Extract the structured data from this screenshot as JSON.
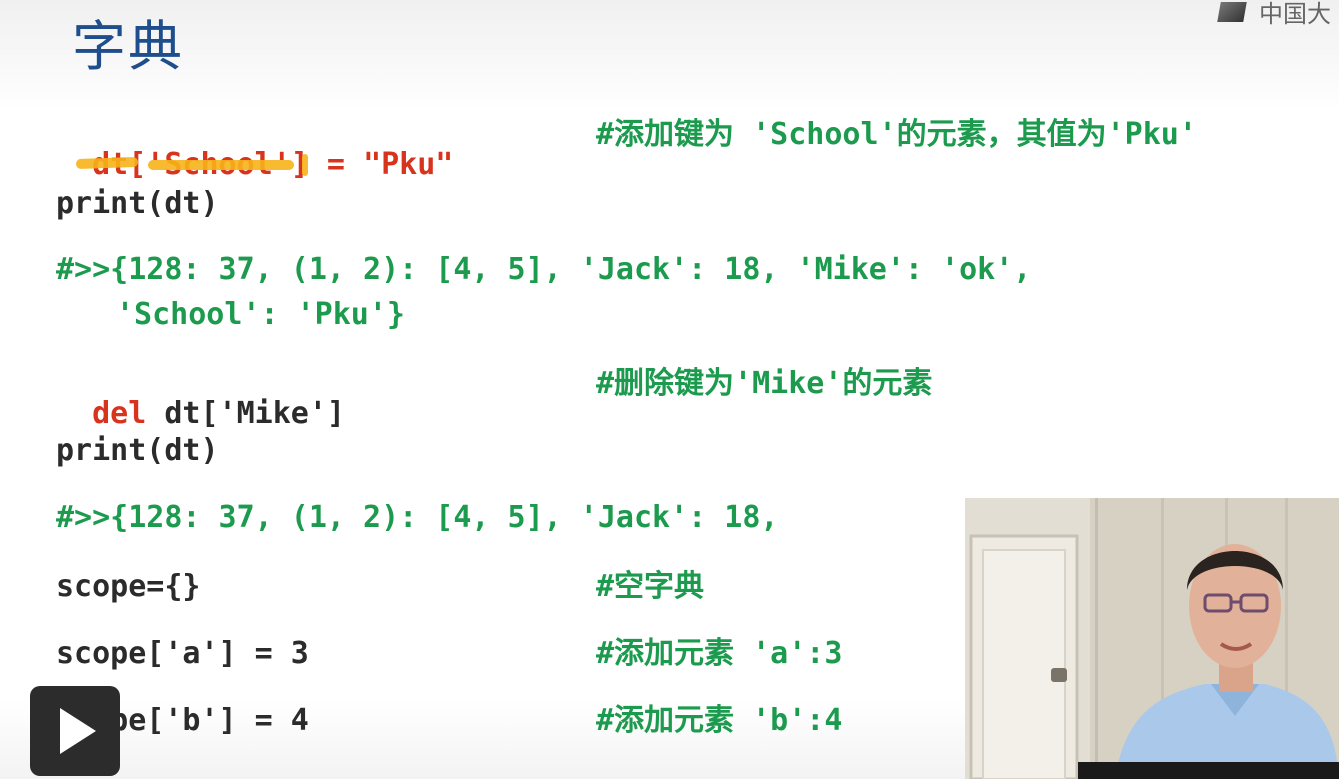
{
  "header": {
    "title": "字典",
    "logo_text": "中国大"
  },
  "code": {
    "line1": {
      "a": "dt['School']",
      "b": " = ",
      "c": "\"Pku\"",
      "comment": "#添加键为 'School'的元素，其值为'Pku'"
    },
    "line2": "print(dt)",
    "line3a": "#>>{128: 37, (1, 2): [4, 5], 'Jack': 18, 'Mike': 'ok',",
    "line3b": "'School': 'Pku'}",
    "line4": {
      "kw": "del",
      "rest": " dt['Mike']",
      "comment": "#删除键为'Mike'的元素"
    },
    "line5": "print(dt)",
    "line6": "#>>{128: 37, (1, 2): [4, 5], 'Jack': 18,",
    "line7": {
      "code": "scope={}",
      "comment": "#空字典"
    },
    "line8": {
      "code": "scope['a'] = 3",
      "comment": "#添加元素 'a':3"
    },
    "line9": {
      "code": "scope['b'] = 4",
      "comment": "#添加元素 'b':4"
    }
  },
  "colors": {
    "keyword": "#d8331c",
    "comment": "#1c9a4e",
    "title": "#1f4e8c",
    "highlight": "#f7b21a"
  },
  "icons": {
    "play": "play-icon"
  }
}
